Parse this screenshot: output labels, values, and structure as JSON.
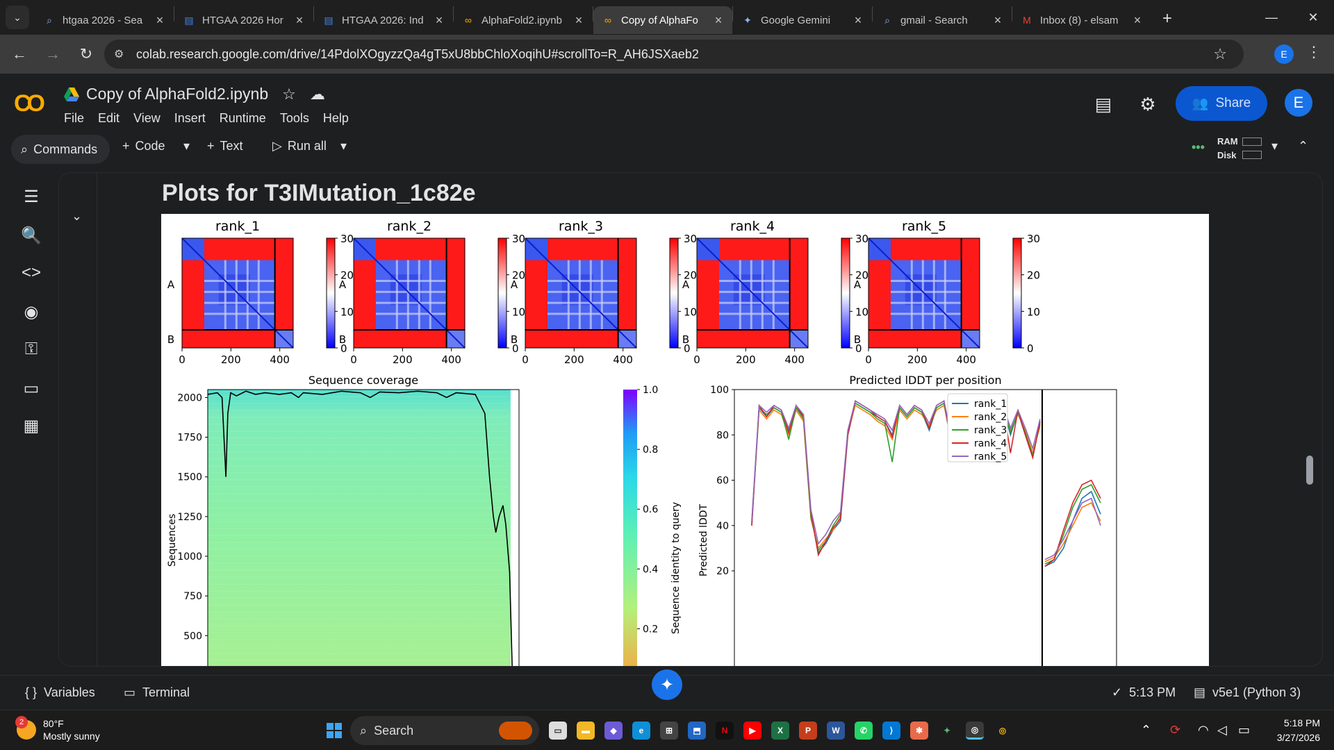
{
  "browser": {
    "tabs": [
      {
        "title": "htgaa 2026 - Sea",
        "icon": "search-icon"
      },
      {
        "title": "HTGAA 2026 Hor",
        "icon": "docs-icon"
      },
      {
        "title": "HTGAA 2026: Ind",
        "icon": "docs-icon"
      },
      {
        "title": "AlphaFold2.ipynb",
        "icon": "colab-icon"
      },
      {
        "title": "Copy of AlphaFo",
        "icon": "colab-icon",
        "active": true
      },
      {
        "title": "Google Gemini",
        "icon": "gemini-icon"
      },
      {
        "title": "gmail - Search",
        "icon": "search-icon"
      },
      {
        "title": "Inbox (8) - elsam",
        "icon": "gmail-icon"
      }
    ],
    "url": "colab.research.google.com/drive/14PdolXOgyzzQa4gT5xU8bbChloXoqihU#scrollTo=R_AH6JSXaeb2",
    "profile_initial": "E"
  },
  "colab": {
    "notebook_title": "Copy of AlphaFold2.ipynb",
    "menu": [
      "File",
      "Edit",
      "View",
      "Insert",
      "Runtime",
      "Tools",
      "Help"
    ],
    "share_label": "Share",
    "profile_initial": "E",
    "toolbar": {
      "commands": "Commands",
      "code": "Code",
      "text": "Text",
      "run_all": "Run all",
      "ram": "RAM",
      "disk": "Disk"
    },
    "output_heading": "Plots for T3IMutation_1c82e",
    "status": {
      "variables": "Variables",
      "terminal": "Terminal",
      "exec_time": "5:13 PM",
      "runtime": "v5e1 (Python 3)"
    }
  },
  "chart_data": [
    {
      "type": "heatmap",
      "panels": [
        {
          "title": "rank_1"
        },
        {
          "title": "rank_2"
        },
        {
          "title": "rank_3"
        },
        {
          "title": "rank_4"
        },
        {
          "title": "rank_5"
        }
      ],
      "chain_labels": [
        "A",
        "B"
      ],
      "chain_boundary": 380,
      "length": 455,
      "x_ticks": [
        0,
        200,
        400
      ],
      "colorbar_ticks": [
        0,
        10,
        20,
        30
      ],
      "colorbar_range": [
        0,
        30
      ]
    },
    {
      "type": "heatmap",
      "title": "Sequence coverage",
      "ylabel": "Sequences",
      "y_ticks": [
        500,
        750,
        1000,
        1250,
        1500,
        1750,
        2000
      ],
      "colorbar_label": "Sequence identity to query",
      "colorbar_ticks": [
        0.2,
        0.4,
        0.6,
        0.8,
        1.0
      ],
      "colorbar_tick_labels": [
        "0.2",
        "0.4",
        "0.6",
        "0.8",
        "1.0"
      ],
      "coverage_line": [
        [
          0,
          2020
        ],
        [
          20,
          2030
        ],
        [
          30,
          2000
        ],
        [
          38,
          1500
        ],
        [
          42,
          1900
        ],
        [
          48,
          2030
        ],
        [
          60,
          2010
        ],
        [
          80,
          2040
        ],
        [
          100,
          2020
        ],
        [
          120,
          2030
        ],
        [
          150,
          2020
        ],
        [
          175,
          2030
        ],
        [
          190,
          2000
        ],
        [
          200,
          2030
        ],
        [
          240,
          2020
        ],
        [
          280,
          2040
        ],
        [
          320,
          2030
        ],
        [
          340,
          2000
        ],
        [
          360,
          2035
        ],
        [
          400,
          2030
        ],
        [
          440,
          2040
        ],
        [
          480,
          2030
        ],
        [
          500,
          2000
        ],
        [
          520,
          2030
        ],
        [
          560,
          2020
        ],
        [
          580,
          1900
        ],
        [
          590,
          1500
        ],
        [
          598,
          1250
        ],
        [
          603,
          1150
        ],
        [
          610,
          1250
        ],
        [
          618,
          1320
        ],
        [
          624,
          1200
        ],
        [
          632,
          900
        ],
        [
          640,
          0
        ]
      ]
    },
    {
      "type": "line",
      "title": "Predicted lDDT per position",
      "ylabel": "Predicted lDDT",
      "y_ticks": [
        20,
        40,
        60,
        80,
        100
      ],
      "ylim": [
        20,
        100
      ],
      "chain_boundary": 380,
      "legend": "top-right",
      "series": [
        {
          "name": "rank_1",
          "color": "#1f77b4",
          "values": [
            40,
            92,
            88,
            92,
            90,
            82,
            92,
            88,
            45,
            28,
            32,
            38,
            42,
            80,
            94,
            92,
            90,
            88,
            86,
            80,
            92,
            88,
            92,
            90,
            82,
            92,
            94,
            76,
            92,
            94,
            90,
            92,
            94,
            88,
            92,
            80,
            90,
            80,
            70,
            86,
            22,
            24,
            30,
            42,
            52,
            55,
            45
          ]
        },
        {
          "name": "rank_2",
          "color": "#ff7f0e",
          "values": [
            42,
            91,
            87,
            91,
            89,
            80,
            91,
            86,
            43,
            30,
            34,
            38,
            44,
            81,
            93,
            91,
            89,
            86,
            84,
            78,
            91,
            87,
            91,
            89,
            84,
            91,
            93,
            78,
            91,
            93,
            89,
            91,
            93,
            87,
            91,
            82,
            89,
            82,
            72,
            84,
            24,
            26,
            32,
            40,
            48,
            50,
            42
          ]
        },
        {
          "name": "rank_3",
          "color": "#2ca02c",
          "values": [
            41,
            92,
            89,
            92,
            90,
            78,
            92,
            87,
            44,
            29,
            33,
            40,
            45,
            82,
            94,
            92,
            90,
            87,
            85,
            68,
            92,
            88,
            92,
            90,
            83,
            92,
            94,
            77,
            92,
            94,
            90,
            92,
            94,
            88,
            92,
            81,
            90,
            81,
            71,
            85,
            23,
            25,
            36,
            48,
            56,
            58,
            50
          ]
        },
        {
          "name": "rank_4",
          "color": "#d62728",
          "values": [
            40,
            93,
            88,
            93,
            91,
            81,
            93,
            88,
            46,
            27,
            33,
            39,
            43,
            80,
            95,
            93,
            91,
            88,
            86,
            79,
            93,
            89,
            93,
            91,
            83,
            93,
            95,
            76,
            93,
            95,
            91,
            93,
            95,
            89,
            93,
            72,
            91,
            80,
            70,
            86,
            22,
            25,
            38,
            50,
            58,
            60,
            52
          ]
        },
        {
          "name": "rank_5",
          "color": "#9467bd",
          "values": [
            42,
            93,
            90,
            93,
            91,
            83,
            93,
            89,
            47,
            32,
            36,
            42,
            46,
            82,
            95,
            93,
            91,
            89,
            87,
            82,
            93,
            89,
            93,
            91,
            85,
            93,
            95,
            79,
            93,
            95,
            91,
            93,
            95,
            89,
            93,
            83,
            91,
            83,
            74,
            87,
            25,
            27,
            34,
            42,
            50,
            52,
            40
          ]
        }
      ]
    }
  ],
  "taskbar": {
    "temperature": "80°F",
    "weather": "Mostly sunny",
    "weather_badge": "2",
    "search_label": "Search",
    "time": "5:18 PM",
    "date": "3/27/2026"
  }
}
